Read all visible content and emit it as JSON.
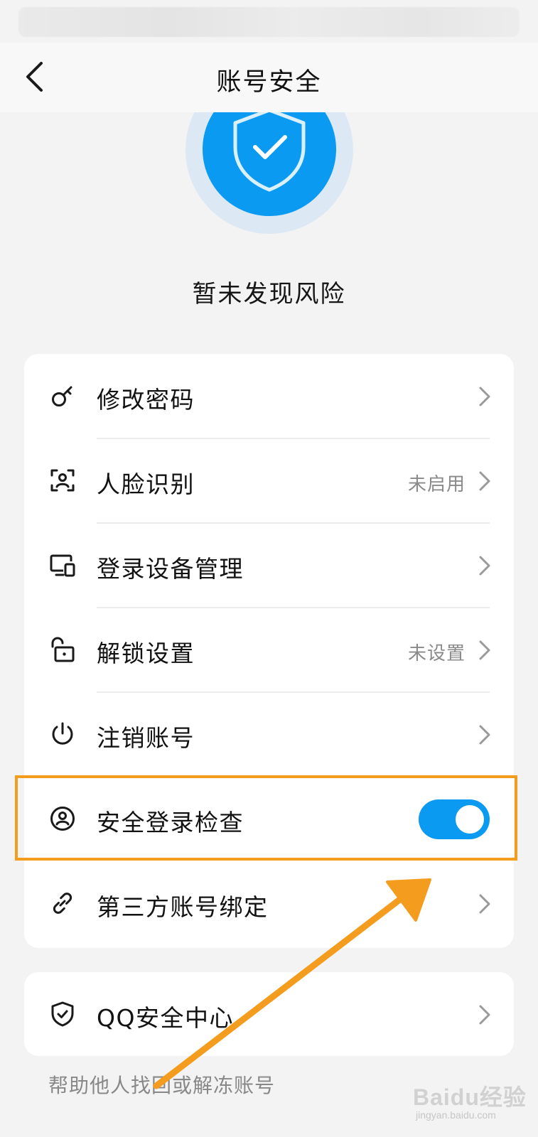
{
  "header": {
    "title": "账号安全"
  },
  "hero": {
    "status_text": "暂未发现风险"
  },
  "menu": {
    "items": [
      {
        "label": "修改密码",
        "value": "",
        "icon": "key-icon"
      },
      {
        "label": "人脸识别",
        "value": "未启用",
        "icon": "face-scan-icon"
      },
      {
        "label": "登录设备管理",
        "value": "",
        "icon": "devices-icon"
      },
      {
        "label": "解锁设置",
        "value": "未设置",
        "icon": "unlock-icon"
      },
      {
        "label": "注销账号",
        "value": "",
        "icon": "power-icon"
      },
      {
        "label": "安全登录检查",
        "toggle": true,
        "icon": "user-circle-icon"
      },
      {
        "label": "第三方账号绑定",
        "value": "",
        "icon": "link-icon"
      }
    ]
  },
  "qq_card": {
    "label": "QQ安全中心",
    "icon": "shield-check-icon"
  },
  "footer": {
    "link_text": "帮助他人找回或解冻账号"
  },
  "watermark": {
    "main": "Baidu经验",
    "sub": "jingyan.baidu.com"
  },
  "colors": {
    "accent": "#0b9af2",
    "annotation": "#f39c1e",
    "background": "#f3f3f3",
    "card": "#ffffff"
  }
}
